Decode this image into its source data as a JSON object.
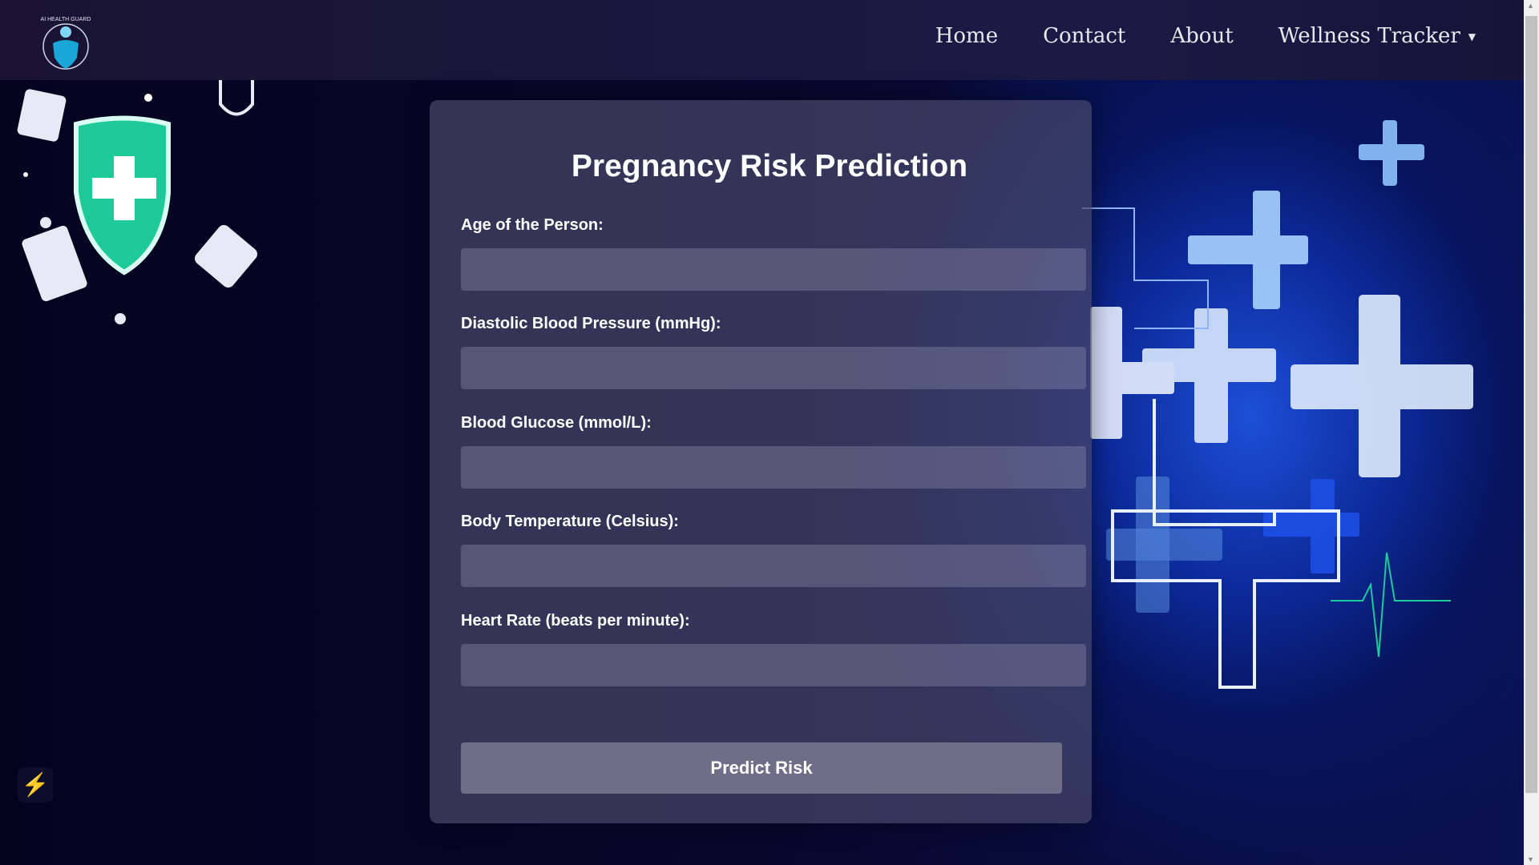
{
  "brand": {
    "logo_text": "AI HEALTH GUARD"
  },
  "nav": {
    "home": "Home",
    "contact": "Contact",
    "about": "About",
    "wellness": "Wellness Tracker"
  },
  "form": {
    "title": "Pregnancy Risk Prediction",
    "fields": [
      {
        "label": "Age of the Person:",
        "value": ""
      },
      {
        "label": "Diastolic Blood Pressure (mmHg):",
        "value": ""
      },
      {
        "label": "Blood Glucose (mmol/L):",
        "value": ""
      },
      {
        "label": "Body Temperature (Celsius):",
        "value": ""
      },
      {
        "label": "Heart Rate (beats per minute):",
        "value": ""
      }
    ],
    "submit": "Predict Risk"
  },
  "colors": {
    "shield": "#1ec99a",
    "accent": "#1d4fd8"
  }
}
